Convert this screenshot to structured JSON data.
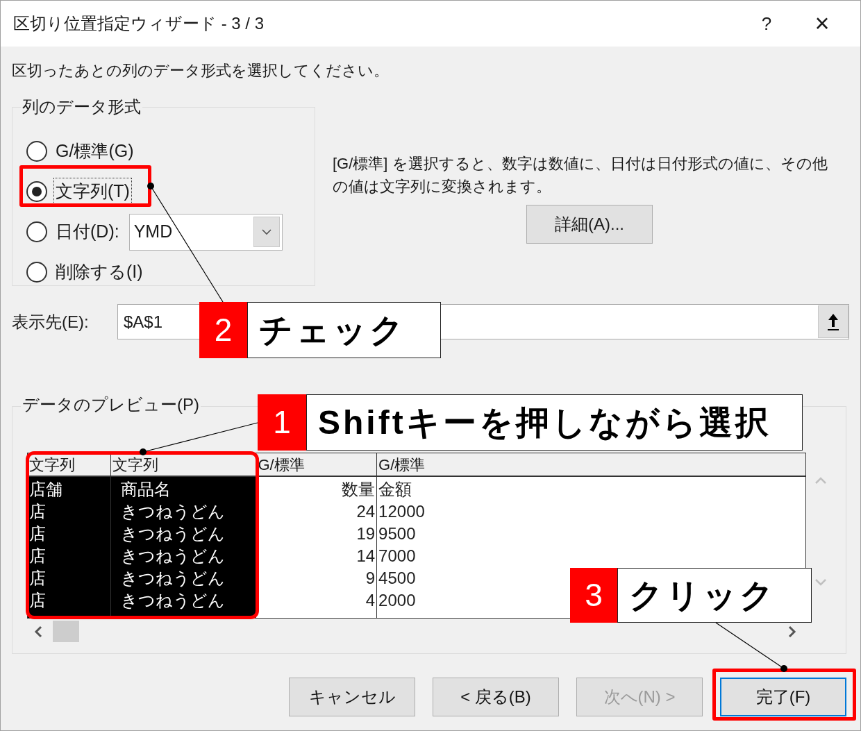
{
  "window": {
    "title": "区切り位置指定ウィザード - 3 / 3",
    "help": "?",
    "close": "×"
  },
  "instruction": "区切ったあとの列のデータ形式を選択してください。",
  "format_group": {
    "title": "列のデータ形式",
    "options": [
      {
        "label": "G/標準(G)",
        "selected": false
      },
      {
        "label": "文字列(T)",
        "selected": true
      },
      {
        "label": "日付(D):",
        "selected": false,
        "dropdown": "YMD"
      },
      {
        "label": "削除する(I)",
        "selected": false
      }
    ]
  },
  "description": "[G/標準] を選択すると、数字は数値に、日付は日付形式の値に、その他の値は文字列に変換されます。",
  "details_button": "詳細(A)...",
  "destination": {
    "label": "表示先(E):",
    "value": "$A$1"
  },
  "preview": {
    "title": "データのプレビュー(P)",
    "columns": [
      {
        "format": "文字列",
        "selected": true
      },
      {
        "format": "文字列",
        "selected": true
      },
      {
        "format": "G/標準",
        "selected": false
      },
      {
        "format": "G/標準",
        "selected": false
      }
    ],
    "rows": [
      [
        "店舗",
        "商品名",
        "数量",
        "金額"
      ],
      [
        "店",
        "きつねうどん",
        "24",
        "12000"
      ],
      [
        "店",
        "きつねうどん",
        "19",
        "9500"
      ],
      [
        "店",
        "きつねうどん",
        "14",
        "7000"
      ],
      [
        "店",
        "きつねうどん",
        "9",
        "4500"
      ],
      [
        "店",
        "きつねうどん",
        "4",
        "2000"
      ]
    ]
  },
  "buttons": [
    {
      "label": "キャンセル",
      "disabled": false,
      "default": false
    },
    {
      "label": "< 戻る(B)",
      "disabled": false,
      "default": false
    },
    {
      "label": "次へ(N) >",
      "disabled": true,
      "default": false
    },
    {
      "label": "完了(F)",
      "disabled": false,
      "default": true
    }
  ],
  "callouts": [
    {
      "number": "2",
      "text": "チェック"
    },
    {
      "number": "1",
      "text": "Shiftキーを押しながら選択"
    },
    {
      "number": "3",
      "text": "クリック"
    }
  ]
}
